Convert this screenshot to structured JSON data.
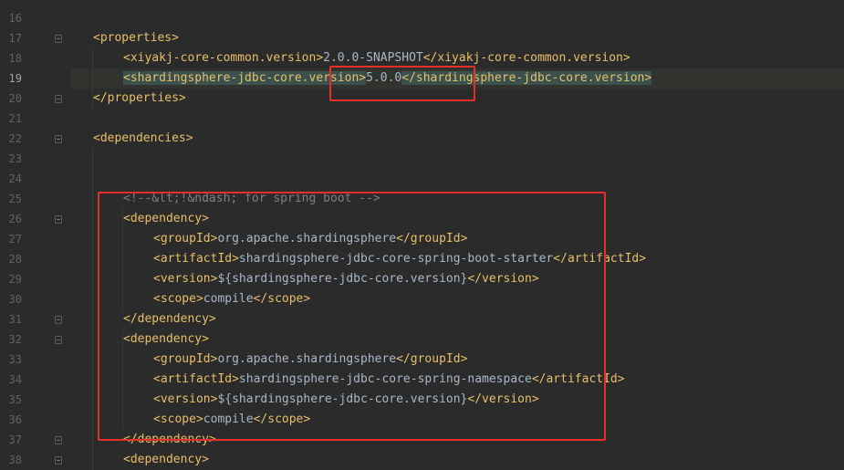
{
  "editor": {
    "lines": [
      {
        "num": "16",
        "segments": []
      },
      {
        "num": "17",
        "fold": true,
        "segments": [
          {
            "c": "tag",
            "t": "<properties>"
          }
        ]
      },
      {
        "num": "18",
        "segments": [
          {
            "c": "tag",
            "t": "<xiyakj-core-common.version>"
          },
          {
            "c": "txt",
            "t": "2.0.0-SNAPSHOT"
          },
          {
            "c": "tag",
            "t": "</xiyakj-core-common.version>"
          }
        ]
      },
      {
        "num": "19",
        "current": true,
        "segments": [
          {
            "c": "tag hl",
            "t": "<shardingsphere-jdbc-core.version>"
          },
          {
            "c": "txt",
            "t": "5.0.0"
          },
          {
            "c": "tag hl",
            "t": "</shardingsphere-jdbc-core.version>"
          }
        ]
      },
      {
        "num": "20",
        "fold": true,
        "segments": [
          {
            "c": "tag",
            "t": "</properties>"
          }
        ]
      },
      {
        "num": "21",
        "segments": []
      },
      {
        "num": "22",
        "fold": true,
        "segments": [
          {
            "c": "tag",
            "t": "<dependencies>"
          }
        ]
      },
      {
        "num": "23",
        "segments": []
      },
      {
        "num": "24",
        "segments": []
      },
      {
        "num": "25",
        "segments": [
          {
            "c": "cmt",
            "t": "<!--&lt;!&ndash; for spring boot -->"
          }
        ]
      },
      {
        "num": "26",
        "fold": true,
        "segments": [
          {
            "c": "tag",
            "t": "<dependency>"
          }
        ]
      },
      {
        "num": "27",
        "segments": [
          {
            "c": "tag",
            "t": "<groupId>"
          },
          {
            "c": "txt",
            "t": "org.apache.shardingsphere"
          },
          {
            "c": "tag",
            "t": "</groupId>"
          }
        ]
      },
      {
        "num": "28",
        "segments": [
          {
            "c": "tag",
            "t": "<artifactId>"
          },
          {
            "c": "txt",
            "t": "shardingsphere-jdbc-core-spring-boot-starter"
          },
          {
            "c": "tag",
            "t": "</artifactId>"
          }
        ]
      },
      {
        "num": "29",
        "segments": [
          {
            "c": "tag",
            "t": "<version>"
          },
          {
            "c": "txt",
            "t": "${shardingsphere-jdbc-core.version}"
          },
          {
            "c": "tag",
            "t": "</version>"
          }
        ]
      },
      {
        "num": "30",
        "segments": [
          {
            "c": "tag",
            "t": "<scope>"
          },
          {
            "c": "txt",
            "t": "compile"
          },
          {
            "c": "tag",
            "t": "</scope>"
          }
        ]
      },
      {
        "num": "31",
        "fold": true,
        "segments": [
          {
            "c": "tag",
            "t": "</dependency>"
          }
        ]
      },
      {
        "num": "32",
        "fold": true,
        "segments": [
          {
            "c": "tag",
            "t": "<dependency>"
          }
        ]
      },
      {
        "num": "33",
        "segments": [
          {
            "c": "tag",
            "t": "<groupId>"
          },
          {
            "c": "txt",
            "t": "org.apache.shardingsphere"
          },
          {
            "c": "tag",
            "t": "</groupId>"
          }
        ]
      },
      {
        "num": "34",
        "segments": [
          {
            "c": "tag",
            "t": "<artifactId>"
          },
          {
            "c": "txt",
            "t": "shardingsphere-jdbc-core-spring-namespace"
          },
          {
            "c": "tag",
            "t": "</artifactId>"
          }
        ]
      },
      {
        "num": "35",
        "segments": [
          {
            "c": "tag",
            "t": "<version>"
          },
          {
            "c": "txt",
            "t": "${shardingsphere-jdbc-core.version}"
          },
          {
            "c": "tag",
            "t": "</version>"
          }
        ]
      },
      {
        "num": "36",
        "segments": [
          {
            "c": "tag",
            "t": "<scope>"
          },
          {
            "c": "txt",
            "t": "compile"
          },
          {
            "c": "tag",
            "t": "</scope>"
          }
        ]
      },
      {
        "num": "37",
        "fold": true,
        "segments": [
          {
            "c": "tag",
            "t": "</dependency>"
          }
        ]
      },
      {
        "num": "38",
        "fold": true,
        "segments": [
          {
            "c": "tag",
            "t": "<dependency>"
          }
        ]
      }
    ]
  },
  "colors": {
    "background": "#2b2b2b",
    "tag": "#e8bf6a",
    "text": "#a9b7c6",
    "comment": "#808080",
    "annotation": "#e5302a"
  }
}
